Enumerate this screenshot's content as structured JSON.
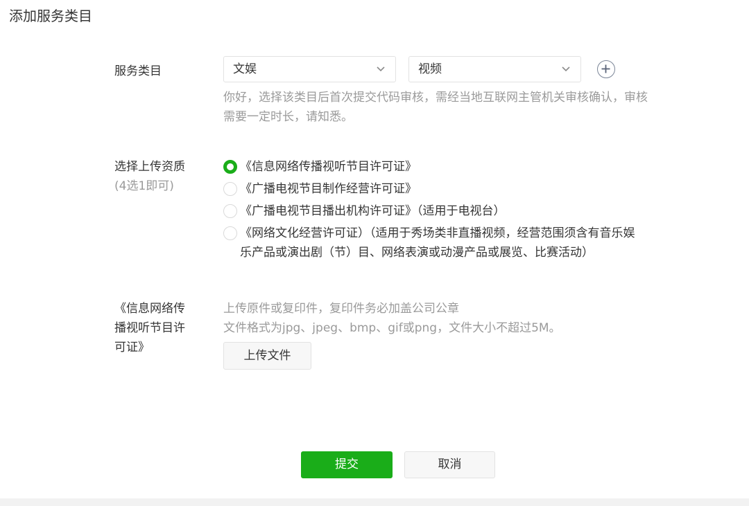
{
  "page_title": "添加服务类目",
  "service_category": {
    "label": "服务类目",
    "primary_select": "文娱",
    "secondary_select": "视频",
    "add_icon": "plus-circle-icon",
    "hint_line1": "你好，选择该类目后首次提交代码审核，需经当地互联网主管机关审核确认，审核",
    "hint_line2": "需要一定时长，请知悉。"
  },
  "qualification": {
    "label": "选择上传资质",
    "sublabel": "(4选1即可)",
    "options": [
      {
        "line1": "《信息网络传播视听节目许可证》",
        "line2": "",
        "checked": true
      },
      {
        "line1": "《广播电视节目制作经营许可证》",
        "line2": "",
        "checked": false
      },
      {
        "line1": "《广播电视节目播出机构许可证》（适用于电视台）",
        "line2": "",
        "checked": false
      },
      {
        "line1": "《网络文化经营许可证）（适用于秀场类非直播视频，经营范围须含有音乐娱",
        "line2": "乐产品或演出剧（节）目、网络表演或动漫产品或展览、比赛活动）",
        "checked": false
      }
    ]
  },
  "upload": {
    "label_line1": "《信息网络传",
    "label_line2": "播视听节目许",
    "label_line3": "可证》",
    "desc_line1": "上传原件或复印件，复印件务必加盖公司公章",
    "desc_line2": "文件格式为jpg、jpeg、bmp、gif或png，文件大小不超过5M。",
    "button": "上传文件"
  },
  "actions": {
    "submit": "提交",
    "cancel": "取消"
  },
  "colors": {
    "accent": "#1aad19",
    "text": "#353535",
    "muted": "#9a9a9a",
    "border": "#e2e2e2"
  }
}
